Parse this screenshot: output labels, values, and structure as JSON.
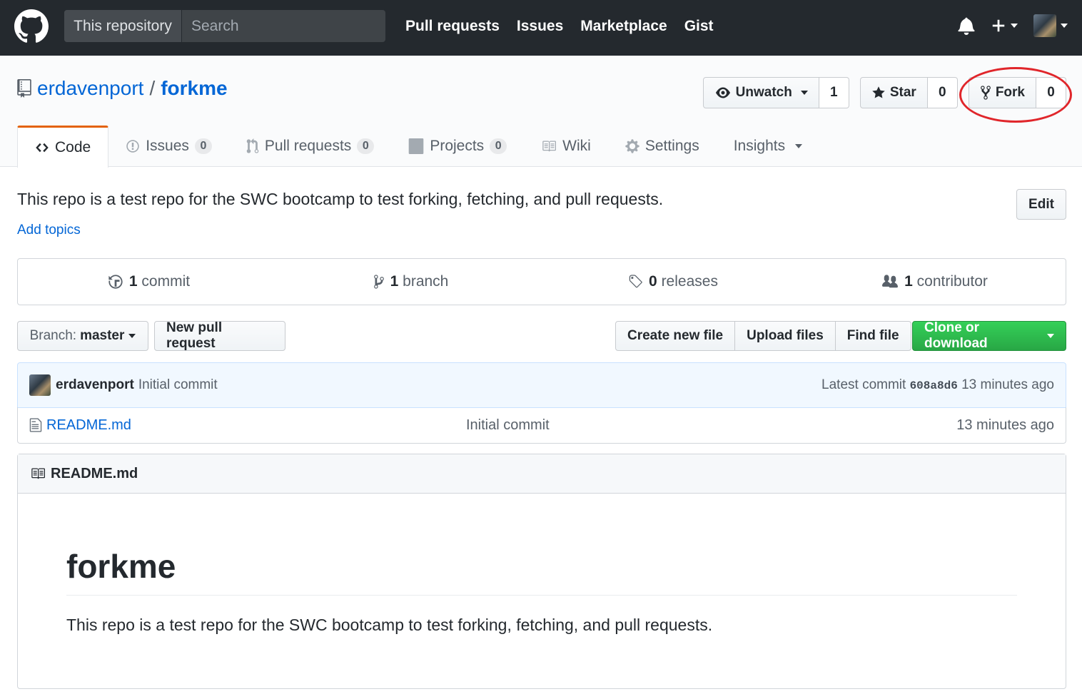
{
  "header": {
    "search_scope": "This repository",
    "search_placeholder": "Search",
    "nav": [
      "Pull requests",
      "Issues",
      "Marketplace",
      "Gist"
    ]
  },
  "repo": {
    "owner": "erdavenport",
    "separator": "/",
    "name": "forkme"
  },
  "actions": {
    "watch_label": "Unwatch",
    "watch_count": "1",
    "star_label": "Star",
    "star_count": "0",
    "fork_label": "Fork",
    "fork_count": "0",
    "highlight_color": "#e0262b"
  },
  "tabs": [
    {
      "label": "Code",
      "icon": "code-icon"
    },
    {
      "label": "Issues",
      "count": "0",
      "icon": "issue-icon"
    },
    {
      "label": "Pull requests",
      "count": "0",
      "icon": "pull-request-icon"
    },
    {
      "label": "Projects",
      "count": "0",
      "icon": "project-icon"
    },
    {
      "label": "Wiki",
      "icon": "book-icon"
    },
    {
      "label": "Settings",
      "icon": "gear-icon"
    },
    {
      "label": "Insights",
      "icon": "chevron-down-icon"
    }
  ],
  "description": {
    "text": "This repo is a test repo for the SWC bootcamp to test forking, fetching, and pull requests.",
    "add_topics": "Add topics",
    "edit_label": "Edit"
  },
  "summary": {
    "commits_num": "1",
    "commits_label": "commit",
    "branches_num": "1",
    "branches_label": "branch",
    "releases_num": "0",
    "releases_label": "releases",
    "contributors_num": "1",
    "contributors_label": "contributor"
  },
  "file_nav": {
    "branch_prefix": "Branch:",
    "branch_name": "master",
    "new_pr": "New pull request",
    "create_file": "Create new file",
    "upload_files": "Upload files",
    "find_file": "Find file",
    "clone": "Clone or download"
  },
  "latest_commit": {
    "author": "erdavenport",
    "message": "Initial commit",
    "prefix": "Latest commit",
    "sha": "608a8d6",
    "age": "13 minutes ago"
  },
  "files": [
    {
      "name": "README.md",
      "message": "Initial commit",
      "age": "13 minutes ago"
    }
  ],
  "readme": {
    "title": "README.md",
    "heading": "forkme",
    "body": "This repo is a test repo for the SWC bootcamp to test forking, fetching, and pull requests."
  }
}
